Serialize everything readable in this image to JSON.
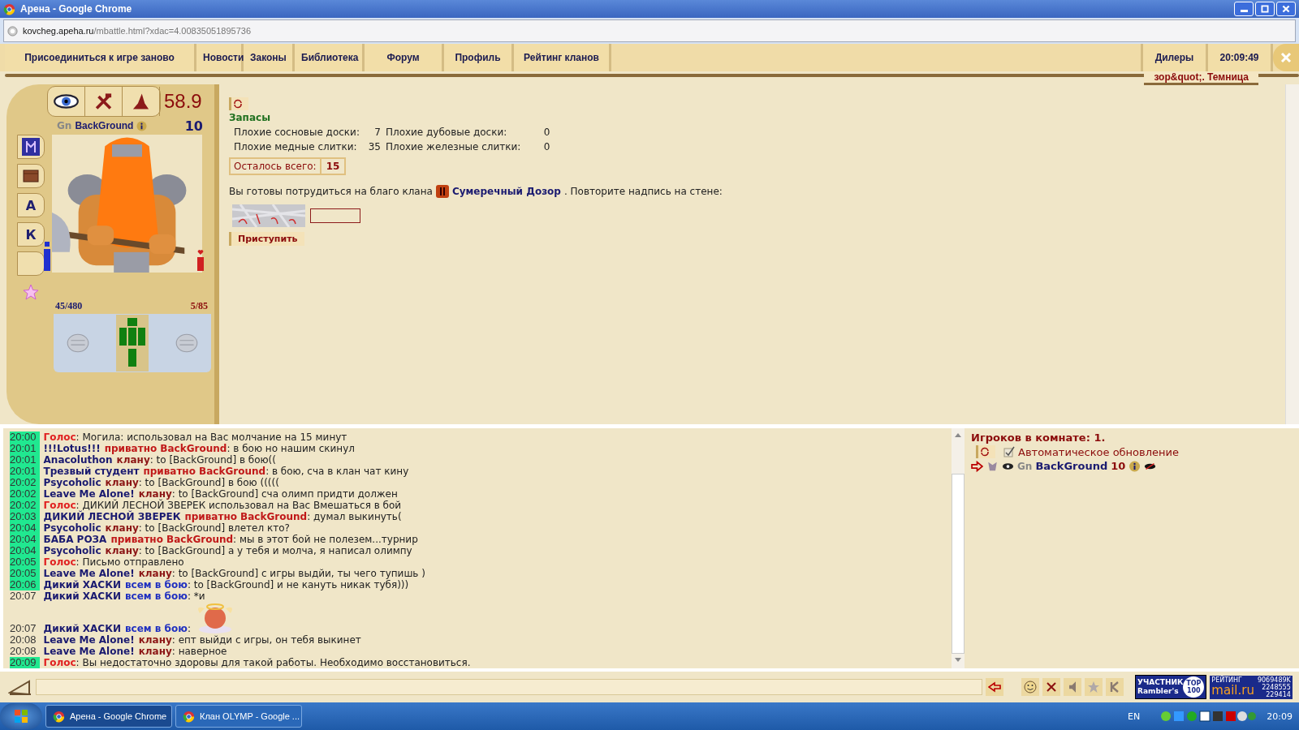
{
  "window": {
    "title": "Арена - Google Chrome"
  },
  "address_bar": {
    "host": "kovcheg.apeha.ru",
    "path": "/mbattle.html?xdac=4.00835051895736"
  },
  "nav": {
    "tabs": [
      {
        "label": "Присоединиться к игре заново"
      },
      {
        "label": "Новости"
      },
      {
        "label": "Законы"
      },
      {
        "label": "Библиотека"
      },
      {
        "label": "Форум"
      },
      {
        "label": "Профиль"
      },
      {
        "label": "Рейтинг кланов"
      }
    ],
    "right_tabs": [
      {
        "label": "Дилеры"
      },
      {
        "label": "20:09:49"
      }
    ],
    "location": "зор&quot;. Темница"
  },
  "character": {
    "rating": "58.9",
    "race": "Gn",
    "name": "BackGround",
    "level": "10",
    "side_tabs": [
      {
        "kind": "rune"
      },
      {
        "kind": "book"
      },
      {
        "kind": "letter",
        "text": "А"
      },
      {
        "kind": "letter",
        "text": "К"
      },
      {
        "kind": "empty"
      }
    ],
    "mana": {
      "reading": "45/480"
    },
    "health": {
      "reading": "5/85"
    }
  },
  "supplies": {
    "title": "Запасы",
    "items": [
      {
        "name": "Плохие сосновые доски:",
        "count": "7"
      },
      {
        "name": "Плохие дубовые доски:",
        "count": "0"
      },
      {
        "name": "Плохие медные слитки:",
        "count": "35"
      },
      {
        "name": "Плохие железные слитки:",
        "count": "0"
      }
    ],
    "remaining_label": "Осталось всего:",
    "remaining": "15",
    "prompt_before": "Вы готовы потрудиться на благо клана",
    "clan": "Сумеречный Дозор",
    "prompt_after": ". Повторите надпись на стене:",
    "button": "Приступить"
  },
  "chat": [
    {
      "time": "20:00",
      "highlighted": true,
      "parts": [
        {
          "kind": "system",
          "text": "Голос"
        }
      ],
      "text": ": Могила: использовал на Вас молчание на 15 минут"
    },
    {
      "time": "20:01",
      "highlighted": true,
      "parts": [
        {
          "kind": "name",
          "text": "!!!Lotus!!!"
        },
        {
          "kind": "private",
          "text": "приватно BackGround"
        }
      ],
      "text": ": в бою но нашим скинул"
    },
    {
      "time": "20:01",
      "highlighted": true,
      "parts": [
        {
          "kind": "name",
          "text": "Anacoluthon"
        },
        {
          "kind": "clan",
          "text": "клану"
        }
      ],
      "text": ": to [BackGround] в бою(("
    },
    {
      "time": "20:01",
      "highlighted": true,
      "parts": [
        {
          "kind": "name",
          "text": "Трезвый студент"
        },
        {
          "kind": "private",
          "text": "приватно BackGround"
        }
      ],
      "text": ": в бою, сча в клан чат кину"
    },
    {
      "time": "20:02",
      "highlighted": true,
      "parts": [
        {
          "kind": "name",
          "text": "Psycoholic"
        },
        {
          "kind": "clan",
          "text": "клану"
        }
      ],
      "text": ": to [BackGround] в бою ((((("
    },
    {
      "time": "20:02",
      "highlighted": true,
      "parts": [
        {
          "kind": "name",
          "text": "Leave Me Alone!"
        },
        {
          "kind": "clan",
          "text": "клану"
        }
      ],
      "text": ": to [BackGround] сча олимп придти должен"
    },
    {
      "time": "20:02",
      "highlighted": true,
      "parts": [
        {
          "kind": "system",
          "text": "Голос"
        }
      ],
      "text": ": ДИКИЙ ЛЕСНОЙ ЗВЕРЕК использовал на Вас Вмешаться в бой"
    },
    {
      "time": "20:03",
      "highlighted": true,
      "parts": [
        {
          "kind": "name",
          "text": "ДИКИЙ ЛЕСНОЙ ЗВЕРЕК"
        },
        {
          "kind": "private",
          "text": "приватно BackGround"
        }
      ],
      "text": ": думал выкинуть("
    },
    {
      "time": "20:04",
      "highlighted": true,
      "parts": [
        {
          "kind": "name",
          "text": "Psycoholic"
        },
        {
          "kind": "clan",
          "text": "клану"
        }
      ],
      "text": ": to [BackGround] влетел кто?"
    },
    {
      "time": "20:04",
      "highlighted": true,
      "parts": [
        {
          "kind": "name",
          "text": "БАБА РОЗА"
        },
        {
          "kind": "private",
          "text": "приватно BackGround"
        }
      ],
      "text": ": мы в этот бой не полезем...турнир"
    },
    {
      "time": "20:04",
      "highlighted": true,
      "parts": [
        {
          "kind": "name",
          "text": "Psycoholic"
        },
        {
          "kind": "clan",
          "text": "клану"
        }
      ],
      "text": ": to [BackGround] а у тебя и молча, я написал олимпу"
    },
    {
      "time": "20:05",
      "highlighted": true,
      "parts": [
        {
          "kind": "system",
          "text": "Голос"
        }
      ],
      "text": ": Письмо отправлено"
    },
    {
      "time": "20:05",
      "highlighted": true,
      "parts": [
        {
          "kind": "name",
          "text": "Leave Me Alone!"
        },
        {
          "kind": "clan",
          "text": "клану"
        }
      ],
      "text": ": to [BackGround] с игры выдйи, ты чего тупишь )"
    },
    {
      "time": "20:06",
      "highlighted": true,
      "parts": [
        {
          "kind": "name",
          "text": "Дикий ХАСКИ"
        },
        {
          "kind": "all",
          "text": "всем в бою"
        }
      ],
      "text": ": to [BackGround] и не кануть никак тубя)))"
    },
    {
      "time": "20:07",
      "highlighted": false,
      "parts": [
        {
          "kind": "name",
          "text": "Дикий ХАСКИ"
        },
        {
          "kind": "all",
          "text": "всем в бою"
        }
      ],
      "text": ": *и"
    },
    {
      "time": "20:07",
      "highlighted": false,
      "parts": [
        {
          "kind": "name",
          "text": "Дикий ХАСКИ"
        },
        {
          "kind": "all",
          "text": "всем в бою"
        }
      ],
      "text": ":",
      "emoticon": {
        "kind": "angel"
      }
    },
    {
      "time": "20:08",
      "highlighted": false,
      "parts": [
        {
          "kind": "name",
          "text": "Leave Me Alone!"
        },
        {
          "kind": "clan",
          "text": "клану"
        }
      ],
      "text": ": епт выйди с игры, он тебя выкинет"
    },
    {
      "time": "20:08",
      "highlighted": false,
      "parts": [
        {
          "kind": "name",
          "text": "Leave Me Alone!"
        },
        {
          "kind": "clan",
          "text": "клану"
        }
      ],
      "text": ": наверное"
    },
    {
      "time": "20:09",
      "highlighted": true,
      "parts": [
        {
          "kind": "system",
          "text": "Голос"
        }
      ],
      "text": ": Вы недостаточно здоровы для такой работы. Необходимо восстановиться."
    }
  ],
  "players": {
    "title": "Игроков в комнате: 1.",
    "auto_refresh": {
      "label": "Автоматическое обновление",
      "checked": true
    },
    "list": [
      {
        "race": "Gn",
        "name": "BackGround",
        "level": "10"
      }
    ]
  },
  "counters": {
    "rambler": {
      "top": "УЧАСТНИК",
      "bottom": "Rambler's",
      "badge": "TOP 100"
    },
    "mail": {
      "top": "РЕЙТИНГ",
      "logo": "mail.ru",
      "values": [
        "9069489K",
        "2248555",
        "229414"
      ]
    }
  },
  "taskbar": {
    "tasks": [
      {
        "label": "Арена - Google Chrome",
        "selected": true
      },
      {
        "label": "Клан OLYMP - Google ...",
        "selected": false
      }
    ],
    "language": "EN",
    "clock": "20:09"
  }
}
